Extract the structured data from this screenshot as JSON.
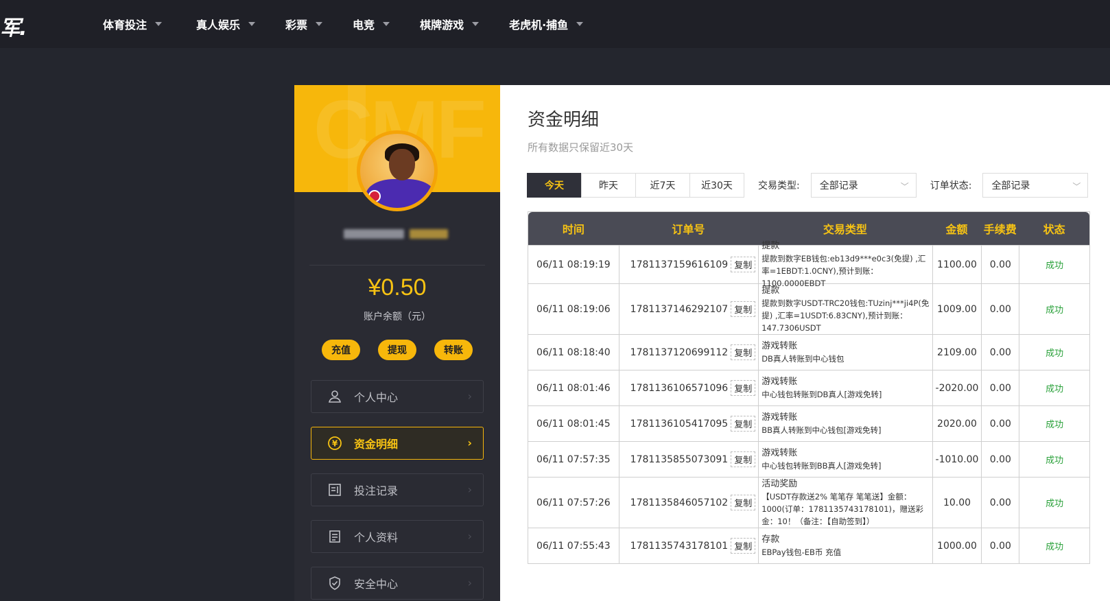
{
  "header": {
    "logo_text": "军.",
    "nav": [
      {
        "label": "体育投注"
      },
      {
        "label": "真人娱乐"
      },
      {
        "label": "彩票"
      },
      {
        "label": "电竞"
      },
      {
        "label": "棋牌游戏"
      },
      {
        "label": "老虎机·捕鱼"
      }
    ]
  },
  "profile": {
    "banner_text": "CMF",
    "balance": "¥0.50",
    "balance_label": "账户余额（元）",
    "actions": [
      "充值",
      "提现",
      "转账"
    ],
    "menu": [
      {
        "label": "个人中心",
        "icon": "user-icon"
      },
      {
        "label": "资金明细",
        "icon": "yen-coin-icon"
      },
      {
        "label": "投注记录",
        "icon": "bet-record-icon"
      },
      {
        "label": "个人资料",
        "icon": "profile-doc-icon"
      },
      {
        "label": "安全中心",
        "icon": "shield-icon"
      }
    ]
  },
  "content": {
    "title": "资金明细",
    "subtitle": "所有数据只保留近30天",
    "tabs": [
      "今天",
      "昨天",
      "近7天",
      "近30天"
    ],
    "filter_type_label": "交易类型:",
    "filter_type_value": "全部记录",
    "filter_status_label": "订单状态:",
    "filter_status_value": "全部记录",
    "columns": [
      "时间",
      "订单号",
      "交易类型",
      "金额",
      "手续费",
      "状态"
    ],
    "copy_label": "复制",
    "rows": [
      {
        "time": "06/11 08:19:19",
        "order": "1781137159616109",
        "type": "提款",
        "detail": "提款到数字EB钱包:eb13d9***e0c3(免提) ,汇率=1EBDT:1.0CNY),预计到账：1100.0000EBDT",
        "amount": "1100.00",
        "fee": "0.00",
        "status": "成功"
      },
      {
        "time": "06/11 08:19:06",
        "order": "1781137146292107",
        "type": "提款",
        "detail": "提款到数字USDT-TRC20钱包:TUzinj***ji4P(免提) ,汇率=1USDT:6.83CNY),预计到账：147.7306USDT",
        "amount": "1009.00",
        "fee": "0.00",
        "status": "成功"
      },
      {
        "time": "06/11 08:18:40",
        "order": "1781137120699112",
        "type": "游戏转账",
        "detail": "DB真人转账到中心钱包",
        "amount": "2109.00",
        "fee": "0.00",
        "status": "成功"
      },
      {
        "time": "06/11 08:01:46",
        "order": "1781136106571096",
        "type": "游戏转账",
        "detail": "中心钱包转账到DB真人[游戏免转]",
        "amount": "-2020.00",
        "fee": "0.00",
        "status": "成功"
      },
      {
        "time": "06/11 08:01:45",
        "order": "1781136105417095",
        "type": "游戏转账",
        "detail": "BB真人转账到中心钱包[游戏免转]",
        "amount": "2020.00",
        "fee": "0.00",
        "status": "成功"
      },
      {
        "time": "06/11 07:57:35",
        "order": "1781135855073091",
        "type": "游戏转账",
        "detail": "中心钱包转账到BB真人[游戏免转]",
        "amount": "-1010.00",
        "fee": "0.00",
        "status": "成功"
      },
      {
        "time": "06/11 07:57:26",
        "order": "1781135846057102",
        "type": "活动奖励",
        "detail": "【USDT存款送2% 笔笔存 笔笔送】金额：1000(订单：1781135743178101)，赠送彩金：10！（备注：【自助签到】）",
        "amount": "10.00",
        "fee": "0.00",
        "status": "成功"
      },
      {
        "time": "06/11 07:55:43",
        "order": "1781135743178101",
        "type": "存款",
        "detail": "EBPay钱包-EB币 充值",
        "amount": "1000.00",
        "fee": "0.00",
        "status": "成功"
      }
    ]
  }
}
